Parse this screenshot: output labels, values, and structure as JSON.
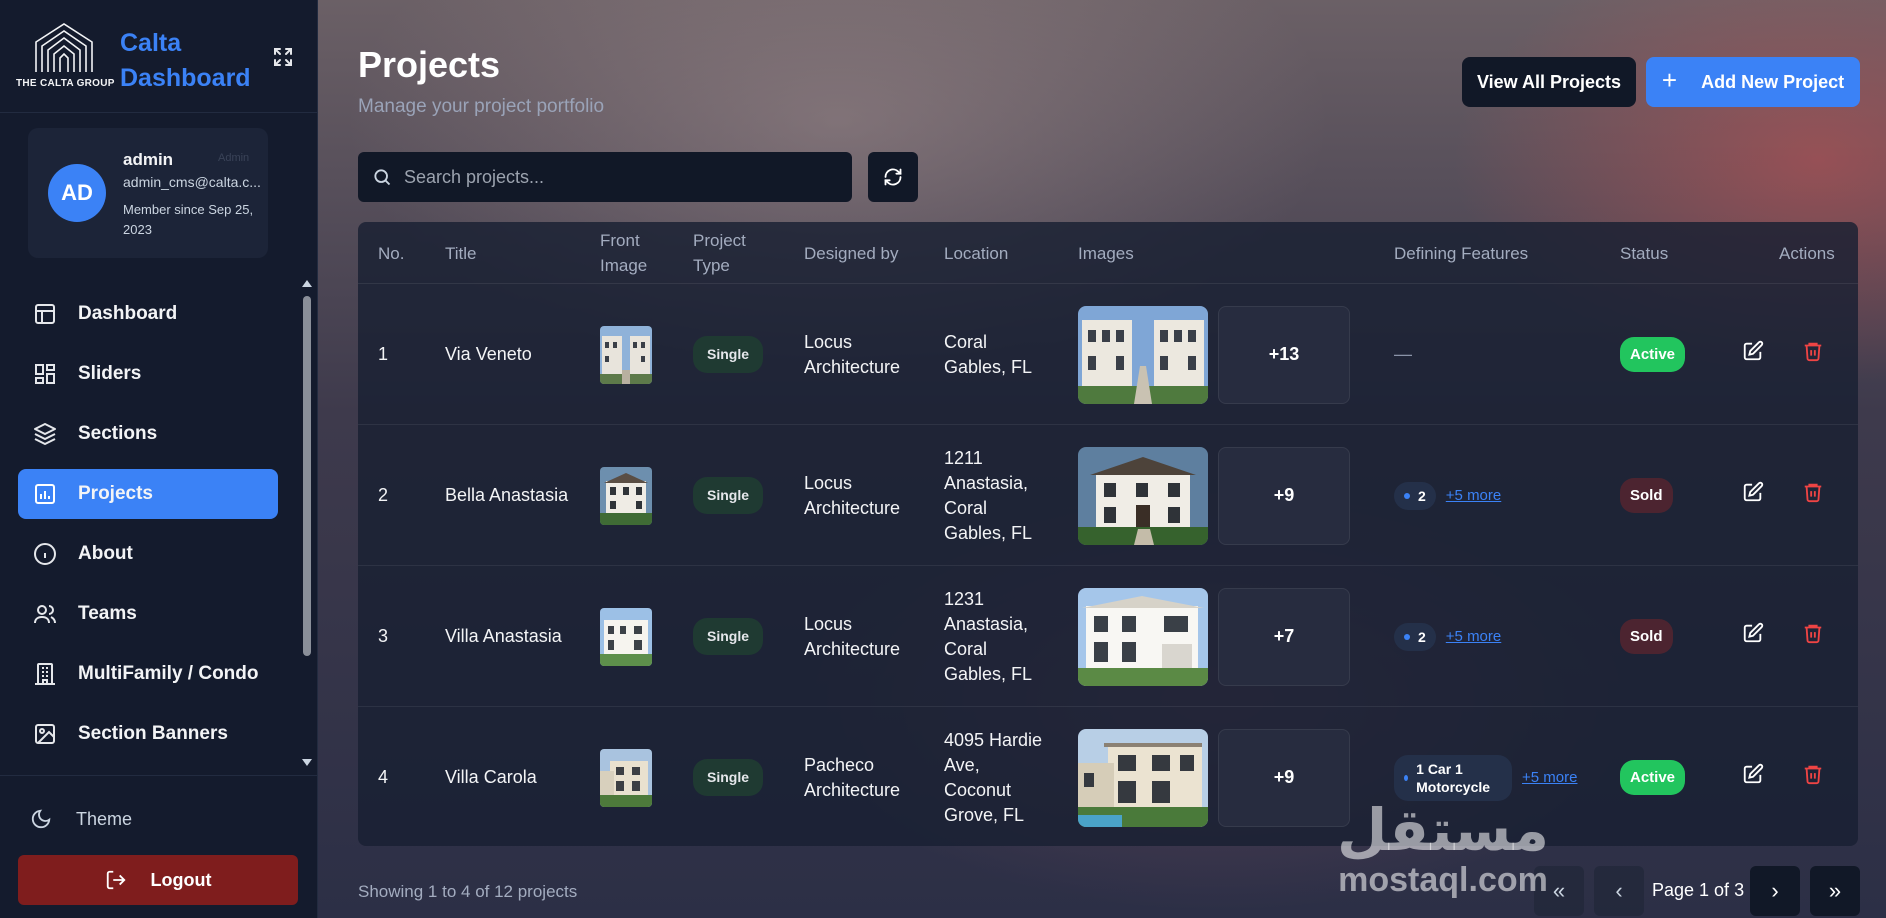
{
  "brand": {
    "logo_text": "THE CALTA GROUP",
    "title": "Calta Dashboard"
  },
  "profile": {
    "initials": "AD",
    "name": "admin",
    "role": "Admin",
    "email": "admin_cms@calta.c...",
    "member_since": "Member since Sep 25, 2023"
  },
  "sidebar": {
    "items": [
      {
        "label": "Dashboard",
        "icon": "layout-icon"
      },
      {
        "label": "Sliders",
        "icon": "grid-icon"
      },
      {
        "label": "Sections",
        "icon": "layers-icon"
      },
      {
        "label": "Projects",
        "icon": "chart-icon",
        "active": true
      },
      {
        "label": "About",
        "icon": "info-icon"
      },
      {
        "label": "Teams",
        "icon": "users-icon"
      },
      {
        "label": "MultiFamily / Condo",
        "icon": "building-icon"
      },
      {
        "label": "Section Banners",
        "icon": "image-icon"
      }
    ],
    "theme_label": "Theme",
    "logout_label": "Logout"
  },
  "header": {
    "title": "Projects",
    "subtitle": "Manage your project portfolio",
    "view_all_label": "View All Projects",
    "add_new_label": "Add New Project"
  },
  "search": {
    "placeholder": "Search projects..."
  },
  "table": {
    "columns": [
      "No.",
      "Title",
      "Front Image",
      "Project Type",
      "Designed by",
      "Location",
      "Images",
      "Defining Features",
      "Status",
      "Actions"
    ],
    "rows": [
      {
        "no": "1",
        "title": "Via Veneto",
        "type": "Single",
        "designer": "Locus Architecture",
        "location": "Coral Gables, FL",
        "images_more": "+13",
        "features": "—",
        "features_more": "",
        "status": "Active"
      },
      {
        "no": "2",
        "title": "Bella Anastasia",
        "type": "Single",
        "designer": "Locus Architecture",
        "location": "1211 Anastasia, Coral Gables, FL",
        "images_more": "+9",
        "features": "2",
        "features_more": "+5 more",
        "status": "Sold"
      },
      {
        "no": "3",
        "title": "Villa Anastasia",
        "type": "Single",
        "designer": "Locus Architecture",
        "location": "1231 Anastasia, Coral Gables, FL",
        "images_more": "+7",
        "features": "2",
        "features_more": "+5 more",
        "status": "Sold"
      },
      {
        "no": "4",
        "title": "Villa Carola",
        "type": "Single",
        "designer": "Pacheco Architecture",
        "location": "4095 Hardie Ave, Coconut Grove, FL",
        "images_more": "+9",
        "features": "1 Car 1 Motorcycle",
        "features_more": "+5 more",
        "status": "Active"
      }
    ]
  },
  "footer": {
    "showing": "Showing 1 to 4 of 12 projects",
    "page_label": "Page 1 of 3"
  },
  "watermark": {
    "arabic": "مستقل",
    "latin": "mostaql.com"
  },
  "colors": {
    "accent": "#3b82f6",
    "active": "#22c55e",
    "sold": "#4c2430",
    "delete": "#ef4444",
    "logout": "#7f1d1d"
  }
}
